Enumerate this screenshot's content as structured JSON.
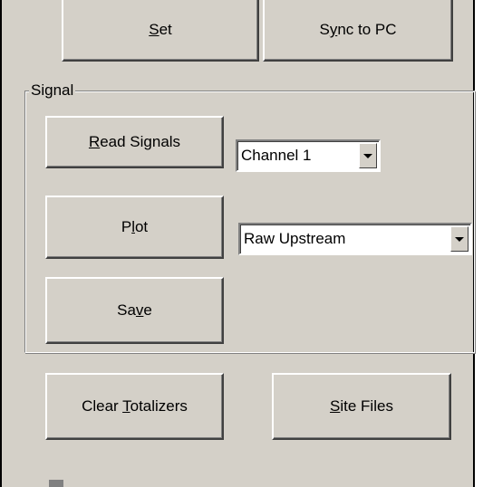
{
  "top_buttons": {
    "set": {
      "pre": "",
      "accel": "S",
      "post": "et"
    },
    "sync": {
      "pre": "S",
      "accel": "y",
      "post": "nc to PC"
    }
  },
  "signal_group": {
    "label": "Signal",
    "read_signals": {
      "pre": "",
      "accel": "R",
      "post": "ead Signals"
    },
    "plot": {
      "pre": "P",
      "accel": "l",
      "post": "ot"
    },
    "save": {
      "pre": "Sa",
      "accel": "v",
      "post": "e"
    },
    "channel_select": {
      "value": "Channel 1"
    },
    "plot_type_select": {
      "value": "Raw Upstream"
    }
  },
  "bottom_buttons": {
    "clear_totalizers": {
      "pre": "Clear ",
      "accel": "T",
      "post": "otalizers"
    },
    "site_files": {
      "pre": "",
      "accel": "S",
      "post": "ite Files"
    }
  },
  "icons": {
    "dropdown": "triangle-down-icon"
  }
}
